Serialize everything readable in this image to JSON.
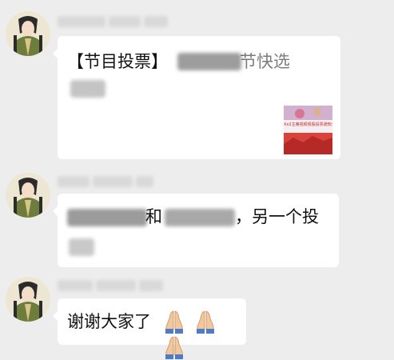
{
  "messages": [
    {
      "kind": "link-card",
      "title_visible": "【节目投票】",
      "title_tail_visible": "节快选",
      "thumbnail_caption": "Xx2主席视频观看投票通知分享"
    },
    {
      "kind": "text",
      "middle_visible": "和",
      "tail_visible": "，另一个投"
    },
    {
      "kind": "text",
      "text": "谢谢大家了",
      "emoji": "folded-hands-emoji",
      "emoji_count": 3
    }
  ],
  "colors": {
    "background": "#ededed",
    "bubble": "#ffffff",
    "text": "#111111",
    "blur_mask": "#b9b9b9"
  }
}
